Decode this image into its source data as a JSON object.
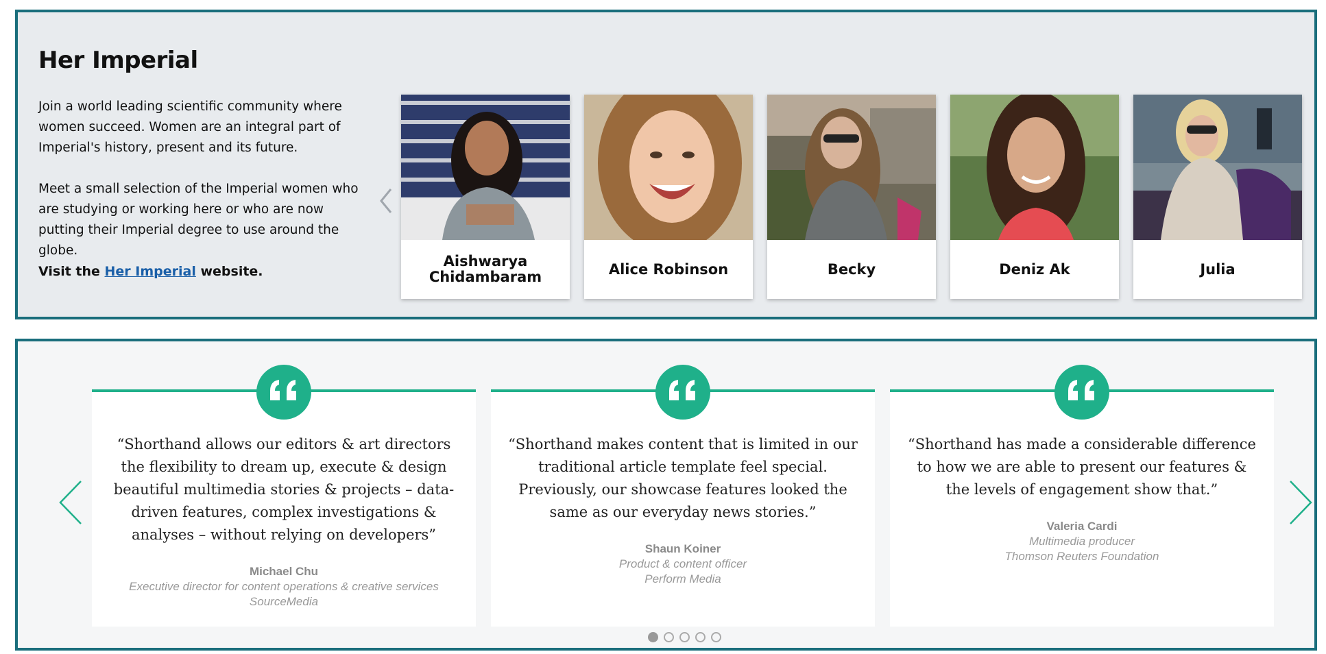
{
  "her_imperial": {
    "title": "Her Imperial",
    "intro": "Join a world leading scientific community where women succeed. Women are an integral part of Imperial's history, present and its future.",
    "meet": "Meet a small selection of the Imperial women who are studying or working here or who are now putting their Imperial degree to use around the globe.",
    "visit_prefix": "Visit the ",
    "visit_link": "Her Imperial",
    "visit_suffix": " website.",
    "people": [
      {
        "name": "Aishwarya Chidambaram"
      },
      {
        "name": "Alice Robinson"
      },
      {
        "name": "Becky"
      },
      {
        "name": "Deniz Ak"
      },
      {
        "name": "Julia"
      }
    ]
  },
  "testimonials": {
    "items": [
      {
        "quote": "“Shorthand allows our editors & art directors the flexibility to dream up, execute & design beautiful multimedia stories & projects – data-driven features, complex investigations & analyses – without relying on developers”",
        "name": "Michael Chu",
        "role": "Executive director for content operations & creative services",
        "org": "SourceMedia"
      },
      {
        "quote": "“Shorthand makes content that is limited in our traditional article template feel special. Previously, our showcase features looked the same as our everyday news stories.”",
        "name": "Shaun Koiner",
        "role": "Product & content officer",
        "org": "Perform Media"
      },
      {
        "quote": "“Shorthand has made a considerable difference to how we are able to present our features & the levels of engagement show that.”",
        "name": "Valeria Cardi",
        "role": "Multimedia producer",
        "org": "Thomson Reuters Foundation"
      }
    ],
    "pagination": {
      "total": 5,
      "active": 1
    }
  },
  "colors": {
    "frame": "#1a6e7c",
    "accent_green": "#1fb08a",
    "link_blue": "#1a5fa8",
    "panel_grey": "#e8ebee"
  },
  "icons": {
    "carousel_prev": "chevron-left-icon",
    "carousel_next": "chevron-right-icon",
    "quote": "quote-icon"
  }
}
